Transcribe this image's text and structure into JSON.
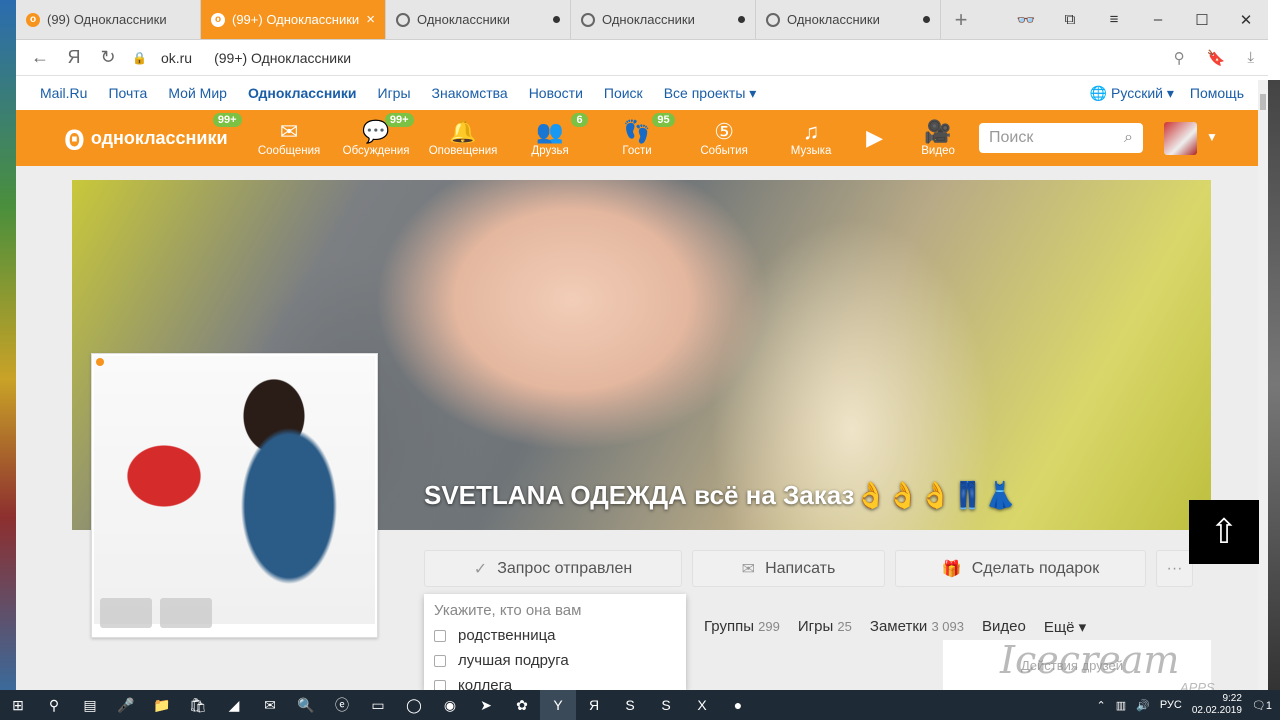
{
  "tabs": [
    {
      "title": "(99) Одноклассники",
      "fav": "ok-icon",
      "active": false
    },
    {
      "title": "(99+) Одноклассники",
      "fav": "ok-icon",
      "active": true
    },
    {
      "title": "Одноклассники",
      "fav": "loading-icon",
      "active": false
    },
    {
      "title": "Одноклассники",
      "fav": "loading-icon",
      "active": false
    },
    {
      "title": "Одноклассники",
      "fav": "loading-icon",
      "active": false
    }
  ],
  "address": {
    "url": "ok.ru",
    "title": "(99+) Одноклассники"
  },
  "portal": {
    "links": [
      "Mail.Ru",
      "Почта",
      "Мой Мир",
      "Одноклассники",
      "Игры",
      "Знакомства",
      "Новости",
      "Поиск",
      "Все проекты ▾"
    ],
    "language": "Русский ▾",
    "help": "Помощь"
  },
  "header": {
    "logo_text": "одноклассники",
    "logo_badge": "99+",
    "items": [
      {
        "label": "Сообщения",
        "icon": "envelope-icon",
        "glyph": "✉",
        "badge": ""
      },
      {
        "label": "Обсуждения",
        "icon": "chat-icon",
        "glyph": "💬",
        "badge": "99+"
      },
      {
        "label": "Оповещения",
        "icon": "bell-icon",
        "glyph": "🔔",
        "badge": ""
      },
      {
        "label": "Друзья",
        "icon": "friends-icon",
        "glyph": "👥",
        "badge": "6"
      },
      {
        "label": "Гости",
        "icon": "footprints-icon",
        "glyph": "👣",
        "badge": "95"
      },
      {
        "label": "События",
        "icon": "events-icon",
        "glyph": "⑤",
        "badge": ""
      },
      {
        "label": "Музыка",
        "icon": "music-icon",
        "glyph": "♫",
        "badge": ""
      },
      {
        "label": "Видео",
        "icon": "video-icon",
        "glyph": "🎥",
        "badge": ""
      }
    ],
    "search_placeholder": "Поиск"
  },
  "profile": {
    "name": "SVETLANA ОДЕЖДА всё на Заказ👌👌👌👖👗",
    "actions": [
      {
        "label": "Запрос отправлен",
        "icon": "check-icon",
        "glyph": "✓"
      },
      {
        "label": "Написать",
        "icon": "envelope-icon",
        "glyph": "✉"
      },
      {
        "label": "Сделать подарок",
        "icon": "gift-icon",
        "glyph": "🎁"
      },
      {
        "label": "",
        "icon": "more-icon",
        "glyph": "···"
      }
    ],
    "relation_hint": "Укажите, кто она вам",
    "relation_options": [
      "родственница",
      "лучшая подруга",
      "коллега"
    ],
    "subnav": [
      {
        "label": "Группы",
        "count": "299"
      },
      {
        "label": "Игры",
        "count": "25"
      },
      {
        "label": "Заметки",
        "count": "3 093"
      },
      {
        "label": "Видео",
        "count": ""
      },
      {
        "label": "Ещё ▾",
        "count": ""
      }
    ],
    "friends_activity": "Действия друзей"
  },
  "watermark": {
    "text": "Icecream",
    "sub": "APPS"
  },
  "taskbar": {
    "lang": "РУС",
    "time": "9:22",
    "date": "02.02.2019",
    "notif": "1"
  }
}
